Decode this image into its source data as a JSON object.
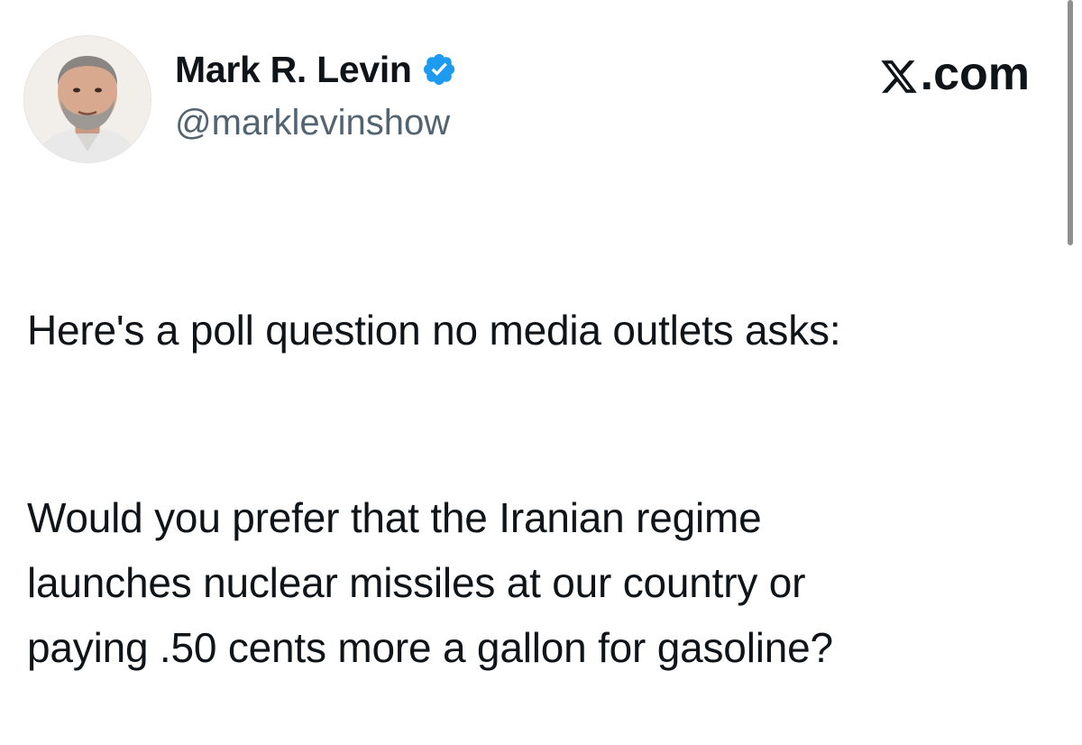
{
  "author": {
    "display_name": "Mark R. Levin",
    "handle": "@marklevinshow",
    "verified": true,
    "avatar_icon": "profile-photo"
  },
  "brand": {
    "label": ".com",
    "logo_icon": "x-logo-icon"
  },
  "tweet": {
    "paragraph_1": "Here's a poll question no media outlets asks:",
    "paragraph_2": "Would you prefer that the Iranian regime\nlaunches nuclear missiles at our country or\npaying .50 cents more a gallon for gasoline?"
  },
  "colors": {
    "text_primary": "#0f1419",
    "text_secondary": "#536471",
    "verified_blue": "#1d9bf0"
  }
}
